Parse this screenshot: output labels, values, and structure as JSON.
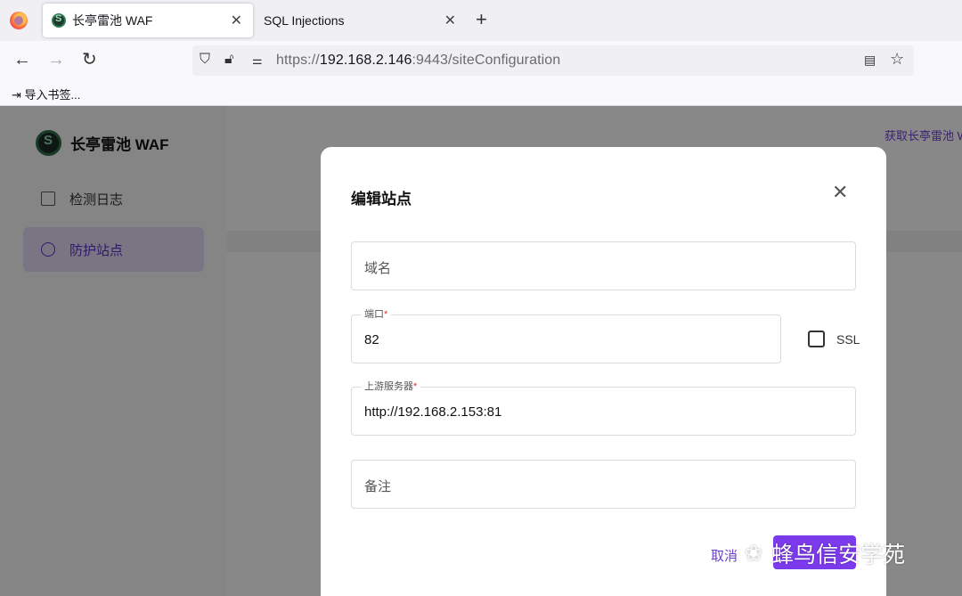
{
  "browser": {
    "tabs": [
      {
        "title": "长亭雷池 WAF",
        "active": true
      },
      {
        "title": "SQL Injections",
        "active": false
      }
    ],
    "url_scheme": "https://",
    "url_host": "192.168.2.146",
    "url_rest": ":9443/siteConfiguration",
    "bookmark_label": "导入书签..."
  },
  "app": {
    "brand": "长亭雷池 WAF",
    "menu": [
      {
        "label": "检测日志",
        "active": false
      },
      {
        "label": "防护站点",
        "active": true
      }
    ],
    "header_link": "获取长亭雷池 W"
  },
  "modal": {
    "title": "编辑站点",
    "domain_placeholder": "域名",
    "port_label": "端口",
    "port_value": "82",
    "ssl_label": "SSL",
    "ssl_checked": false,
    "upstream_label": "上游服务器",
    "upstream_value": "http://192.168.2.153:81",
    "remark_placeholder": "备注",
    "cancel_label": "取消",
    "submit_label": ""
  },
  "watermark": "蜂鸟信安学苑",
  "colors": {
    "accent": "#7c3aed",
    "link": "#6a3fd0",
    "overlay": "rgba(0,0,0,0.45)"
  }
}
